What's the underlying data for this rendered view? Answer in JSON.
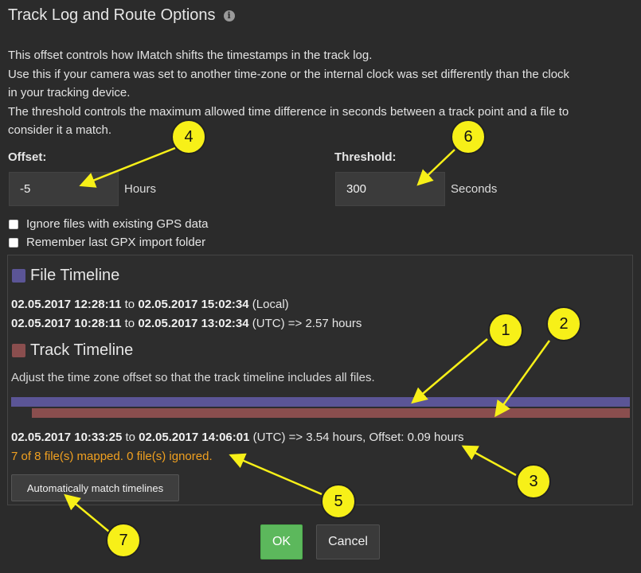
{
  "dialog": {
    "title": "Track Log and Route Options",
    "description": [
      "This offset controls how IMatch shifts the timestamps in the track log.",
      "Use this if your camera was set to another time-zone or the internal clock was set differently than the clock",
      "in your tracking device.",
      "The threshold controls the maximum allowed time difference in seconds between a track point and a file to",
      "consider it a match."
    ]
  },
  "offset": {
    "label": "Offset:",
    "value": "-5",
    "unit": "Hours"
  },
  "threshold": {
    "label": "Threshold:",
    "value": "300",
    "unit": "Seconds"
  },
  "options": {
    "ignore_gps": {
      "label": "Ignore files with existing GPS data",
      "checked": false
    },
    "remember_folder": {
      "label": "Remember last GPX import folder",
      "checked": false
    }
  },
  "file_timeline": {
    "title": "File Timeline",
    "color": "#5b5596",
    "local": {
      "start": "02.05.2017 12:28:11",
      "sep": "to",
      "end": "02.05.2017 15:02:34",
      "suffix": "(Local)"
    },
    "utc": {
      "start": "02.05.2017 10:28:11",
      "sep": "to",
      "end": "02.05.2017 13:02:34",
      "suffix": "(UTC) => 2.57 hours"
    }
  },
  "track_timeline": {
    "title": "Track Timeline",
    "color": "#8a4e4e",
    "hint": "Adjust the time zone offset so that the track timeline includes all files.",
    "utc": {
      "start": "02.05.2017 10:33:25",
      "sep": "to",
      "end": "02.05.2017 14:06:01",
      "suffix": "(UTC) => 3.54 hours, Offset: 0.09 hours"
    },
    "status": "7 of 8 file(s) mapped. 0 file(s) ignored."
  },
  "buttons": {
    "auto_match": "Automatically match timelines",
    "ok": "OK",
    "cancel": "Cancel"
  },
  "callouts": [
    "1",
    "2",
    "3",
    "4",
    "5",
    "6",
    "7"
  ],
  "colors": {
    "background": "#2b2b2b",
    "accent_ok": "#5cb85c",
    "status_orange": "#f0a020",
    "callout": "#f7f018"
  }
}
